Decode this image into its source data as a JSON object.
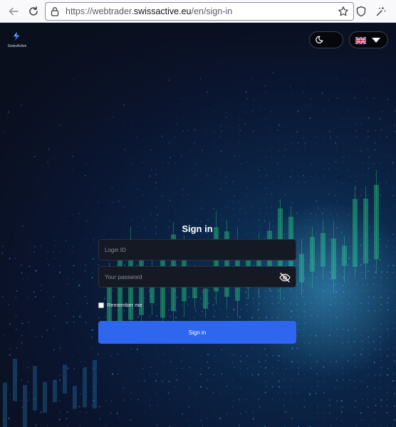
{
  "browser": {
    "url_prefix": "https://webtrader.",
    "url_domain": "swissactive.eu",
    "url_path": "/en/sign-in",
    "icons": [
      "back-arrow-icon",
      "reload-icon",
      "lock-icon",
      "bookmark-star-icon",
      "shield-icon",
      "extension-icon"
    ]
  },
  "header": {
    "brand_name": "SwissActive",
    "theme_icon": "moon-icon",
    "language_flag": "uk-flag",
    "language_caret": "caret-down-icon"
  },
  "login_form": {
    "title": "Sign in",
    "login_placeholder": "Login ID",
    "password_placeholder": "Your password",
    "password_toggle_icon": "eye-off-icon",
    "remember_label": "Remember me",
    "remember_checked": false,
    "submit_label": "Sign in"
  },
  "colors": {
    "accent": "#2f66f0",
    "background": "#0b1120",
    "candles": "#1f9e6e",
    "input_bg": "#151923"
  }
}
